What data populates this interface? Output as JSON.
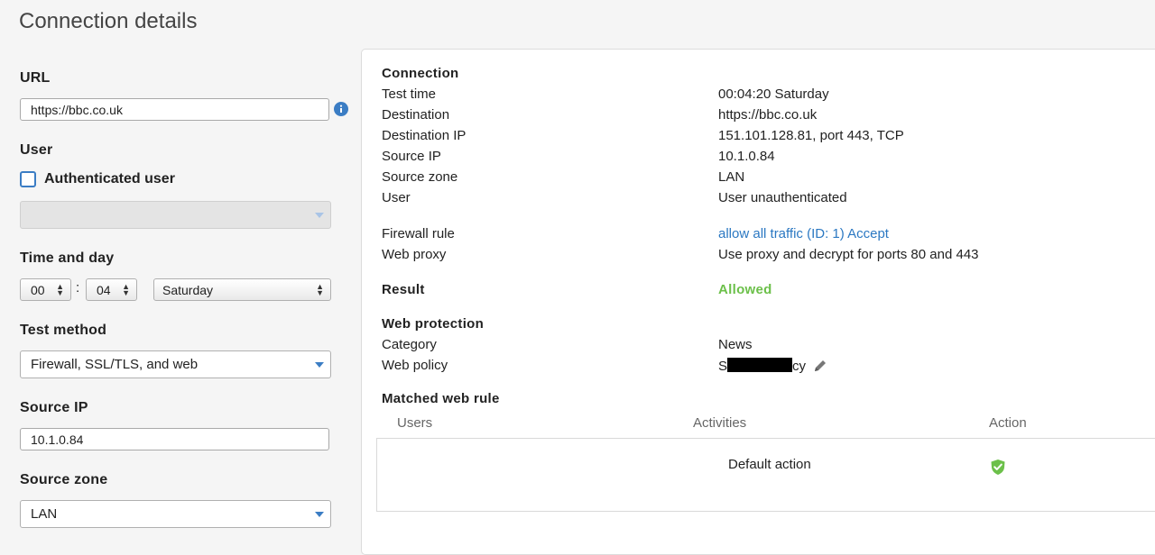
{
  "page": {
    "title": "Connection details"
  },
  "form": {
    "url_label": "URL",
    "url_value": "https://bbc.co.uk",
    "user_label": "User",
    "auth_user_label": "Authenticated user",
    "time_label": "Time and day",
    "hour": "00",
    "minute": "04",
    "colon": ":",
    "day": "Saturday",
    "test_method_label": "Test method",
    "test_method": "Firewall, SSL/TLS, and web",
    "source_ip_label": "Source IP",
    "source_ip": "10.1.0.84",
    "source_zone_label": "Source zone",
    "source_zone": "LAN"
  },
  "details": {
    "connection_heading": "Connection",
    "test_time_k": "Test time",
    "test_time_v": "00:04:20 Saturday",
    "destination_k": "Destination",
    "destination_v": "https://bbc.co.uk",
    "dest_ip_k": "Destination IP",
    "dest_ip_v": "151.101.128.81, port 443, TCP",
    "source_ip_k": "Source IP",
    "source_ip_v": "10.1.0.84",
    "source_zone_k": "Source zone",
    "source_zone_v": "LAN",
    "user_k": "User",
    "user_v": "User unauthenticated",
    "firewall_rule_k": "Firewall rule",
    "firewall_rule_v": "allow all traffic (ID: 1) Accept",
    "web_proxy_k": "Web proxy",
    "web_proxy_v": "Use proxy and decrypt for ports 80 and 443",
    "result_k": "Result",
    "result_v": "Allowed",
    "web_protection_heading": "Web protection",
    "category_k": "Category",
    "category_v": "News",
    "web_policy_k": "Web policy",
    "web_policy_prefix": "S",
    "web_policy_suffix": "cy",
    "matched_rule_heading": "Matched web rule"
  },
  "table": {
    "col_users": "Users",
    "col_activities": "Activities",
    "col_action": "Action",
    "row_default": "Default action"
  },
  "colors": {
    "accent": "#3b7dc4",
    "link": "#2b78c2",
    "allowed": "#6cc04a"
  }
}
